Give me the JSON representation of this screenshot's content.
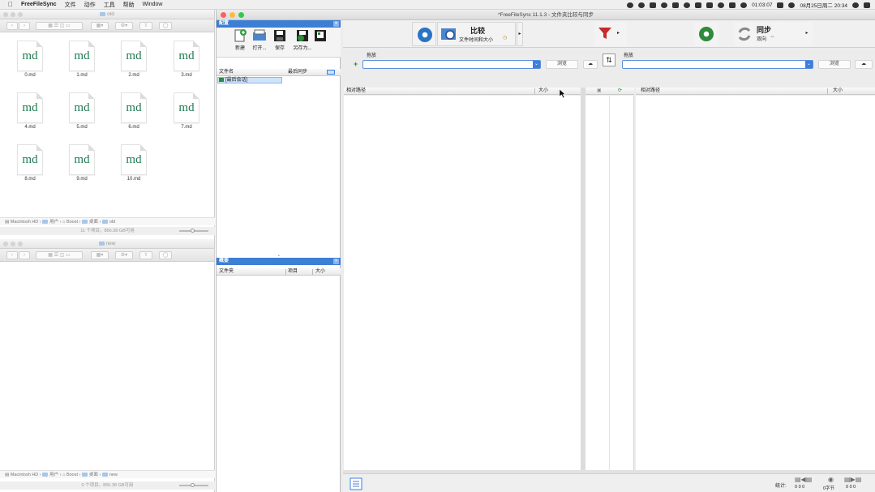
{
  "menubar": {
    "app_name": "FreeFileSync",
    "items": [
      "文件",
      "动作",
      "工具",
      "帮助",
      "Window"
    ],
    "time": "01:03:07",
    "date": "08月25日周二 20:34"
  },
  "finder_top": {
    "title": "old",
    "files": [
      "0.md",
      "1.md",
      "2.md",
      "3.md",
      "4.md",
      "5.md",
      "6.md",
      "7.md",
      "8.md",
      "9.md",
      "10.md"
    ],
    "icon_text": "md",
    "path": [
      "Macintosh HD",
      "用户",
      "Boost",
      "桌面",
      "old"
    ],
    "status": "11 个项目，856.38 GB可用"
  },
  "finder_bottom": {
    "title": "new",
    "path": [
      "Macintosh HD",
      "用户",
      "Boost",
      "桌面",
      "new"
    ],
    "status": "0 个项目，856.38 GB可用"
  },
  "ffs": {
    "window_title": "*FreeFileSync 11.1.3 - 文件夹比较与同步",
    "config_panel": {
      "title": "配置",
      "buttons": [
        "新建",
        "打开...",
        "保存",
        "另存为..."
      ],
      "col_name": "文件名",
      "col_last_sync": "最后同步",
      "item": "[最后会话]"
    },
    "overview_panel": {
      "title": "概要",
      "col_folder": "文件夹",
      "col_items": "项目",
      "col_size": "大小"
    },
    "compare": {
      "label": "比较",
      "sub": "文件时间和大小"
    },
    "sync": {
      "label": "同步",
      "sub": "双向"
    },
    "left": {
      "label": "拖放",
      "browse": "浏览",
      "col_path": "相对路径",
      "col_size": "大小"
    },
    "right": {
      "label": "拖放",
      "browse": "浏览",
      "col_path": "相对路径",
      "col_size": "大小"
    },
    "status": {
      "label": "统计:",
      "left_counts": "0 0 0",
      "bytes": "0字节",
      "right_counts": "0 0 0"
    }
  }
}
